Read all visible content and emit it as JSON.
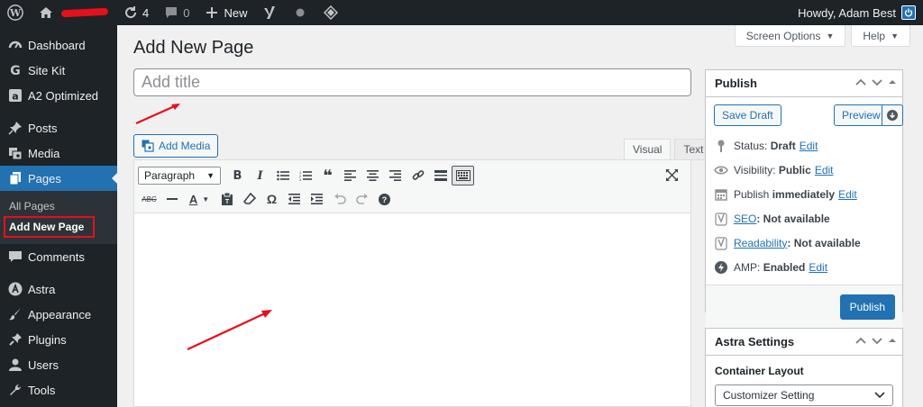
{
  "adminbar": {
    "updates_count": "4",
    "comments_count": "0",
    "new_label": "New",
    "howdy": "Howdy, Adam Best"
  },
  "sidebar": {
    "items": [
      {
        "label": "Dashboard",
        "icon": "dashboard-icon"
      },
      {
        "label": "Site Kit",
        "icon": "sitekit-icon"
      },
      {
        "label": "A2 Optimized",
        "icon": "a2-icon"
      },
      {
        "label": "Posts",
        "icon": "pin-icon"
      },
      {
        "label": "Media",
        "icon": "media-icon"
      },
      {
        "label": "Pages",
        "icon": "pages-icon"
      },
      {
        "label": "Comments",
        "icon": "comment-icon"
      },
      {
        "label": "Astra",
        "icon": "astra-icon"
      },
      {
        "label": "Appearance",
        "icon": "brush-icon"
      },
      {
        "label": "Plugins",
        "icon": "plug-icon"
      },
      {
        "label": "Users",
        "icon": "user-icon"
      },
      {
        "label": "Tools",
        "icon": "wrench-icon"
      }
    ],
    "submenu": [
      "All Pages",
      "Add New Page"
    ]
  },
  "screen_options": "Screen Options",
  "help": "Help",
  "page_title": "Add New Page",
  "title_placeholder": "Add title",
  "add_media": "Add Media",
  "editor_tabs": [
    "Visual",
    "Text"
  ],
  "toolbar": {
    "format_select": "Paragraph"
  },
  "publish_box": {
    "title": "Publish",
    "save_draft": "Save Draft",
    "preview": "Preview",
    "status_label": "Status:",
    "status_value": "Draft",
    "visibility_label": "Visibility:",
    "visibility_value": "Public",
    "publish_label": "Publish",
    "publish_value": "immediately",
    "seo_label": "SEO",
    "seo_value": ": Not available",
    "readability_label": "Readability",
    "readability_value": ": Not available",
    "amp_label": "AMP:",
    "amp_value": "Enabled",
    "edit": "Edit",
    "publish_button": "Publish"
  },
  "astra_box": {
    "title": "Astra Settings",
    "container_label": "Container Layout",
    "container_value": "Customizer Setting"
  },
  "colors": {
    "accent": "#2271b1",
    "sidebar_bg": "#1d2327",
    "annotation_red": "#e5101b"
  }
}
